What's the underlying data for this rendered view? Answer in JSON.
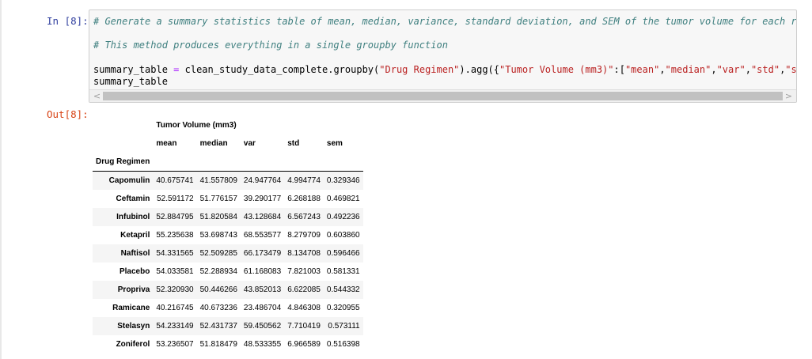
{
  "cell": {
    "input_prompt": "In [8]:",
    "output_prompt": "Out[8]:",
    "code_lines": [
      "# Generate a summary statistics table of mean, median, variance, standard deviation, and SEM of the tumor volume for each regimen",
      "# This method produces everything in a single groupby function",
      "summary_table = clean_study_data_complete.groupby(\"Drug Regimen\").agg({\"Tumor Volume (mm3)\":[\"mean\",\"median\",\"var\",\"std\",\"sem\"]})",
      "summary_table"
    ]
  },
  "scrollbar": {
    "left_arrow": "<",
    "right_arrow": ">"
  },
  "table": {
    "column_group": "Tumor Volume (mm3)",
    "columns": [
      "mean",
      "median",
      "var",
      "std",
      "sem"
    ],
    "index_name": "Drug Regimen",
    "rows": [
      {
        "regimen": "Capomulin",
        "values": [
          "40.675741",
          "41.557809",
          "24.947764",
          "4.994774",
          "0.329346"
        ]
      },
      {
        "regimen": "Ceftamin",
        "values": [
          "52.591172",
          "51.776157",
          "39.290177",
          "6.268188",
          "0.469821"
        ]
      },
      {
        "regimen": "Infubinol",
        "values": [
          "52.884795",
          "51.820584",
          "43.128684",
          "6.567243",
          "0.492236"
        ]
      },
      {
        "regimen": "Ketapril",
        "values": [
          "55.235638",
          "53.698743",
          "68.553577",
          "8.279709",
          "0.603860"
        ]
      },
      {
        "regimen": "Naftisol",
        "values": [
          "54.331565",
          "52.509285",
          "66.173479",
          "8.134708",
          "0.596466"
        ]
      },
      {
        "regimen": "Placebo",
        "values": [
          "54.033581",
          "52.288934",
          "61.168083",
          "7.821003",
          "0.581331"
        ]
      },
      {
        "regimen": "Propriva",
        "values": [
          "52.320930",
          "50.446266",
          "43.852013",
          "6.622085",
          "0.544332"
        ]
      },
      {
        "regimen": "Ramicane",
        "values": [
          "40.216745",
          "40.673236",
          "23.486704",
          "4.846308",
          "0.320955"
        ]
      },
      {
        "regimen": "Stelasyn",
        "values": [
          "54.233149",
          "52.431737",
          "59.450562",
          "7.710419",
          "0.573111"
        ]
      },
      {
        "regimen": "Zoniferol",
        "values": [
          "53.236507",
          "51.818479",
          "48.533355",
          "6.966589",
          "0.516398"
        ]
      }
    ]
  }
}
